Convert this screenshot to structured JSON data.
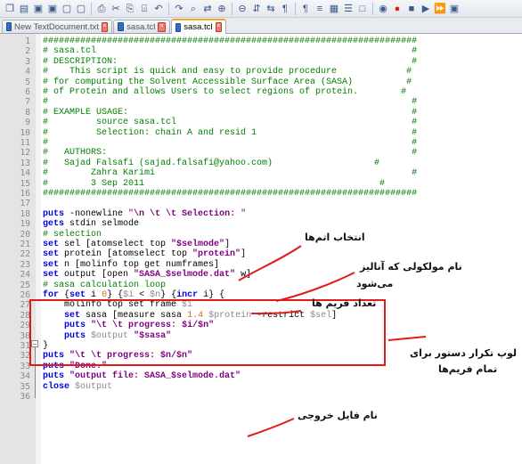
{
  "toolbar": {
    "icons": [
      "new-file-icon",
      "open-icon",
      "save-icon",
      "save-all-icon",
      "close-icon",
      "close-all-icon",
      "print-icon",
      "cut-icon",
      "copy-icon",
      "paste-icon",
      "undo-icon",
      "redo-icon",
      "find-icon",
      "replace-icon",
      "zoom-in-icon",
      "zoom-out-icon",
      "sync-v-icon",
      "sync-h-icon",
      "wrap-icon",
      "all-chars-icon",
      "indent-guide-icon",
      "doc-map-icon",
      "function-list-icon",
      "folder-icon",
      "monitor-icon",
      "record-icon",
      "stop-icon",
      "play-icon",
      "play-multi-icon",
      "save-macro-icon"
    ],
    "glyphs": [
      "❐",
      "▤",
      "▣",
      "▣",
      "▢",
      "▢",
      "⎙",
      "✂",
      "⎘",
      "⌹",
      "↶",
      "↷",
      "⌕",
      "⇄",
      "⊕",
      "⊖",
      "⇵",
      "⇆",
      "¶",
      "¶",
      "≡",
      "▦",
      "☰",
      "□",
      "◉",
      "●",
      "■",
      "▶",
      "⏩",
      "▣"
    ]
  },
  "tabs": [
    {
      "label": "New TextDocument.txt",
      "active": false
    },
    {
      "label": "sasa.tcl",
      "active": false
    },
    {
      "label": "sasa.tcl",
      "active": true
    }
  ],
  "lines": [
    {
      "n": "1",
      "segs": [
        {
          "c": "cm",
          "t": "######################################################################"
        }
      ]
    },
    {
      "n": "2",
      "segs": [
        {
          "c": "cm",
          "t": "# sasa.tcl                                                           #"
        }
      ]
    },
    {
      "n": "3",
      "segs": [
        {
          "c": "cm",
          "t": "# DESCRIPTION:                                                       #"
        }
      ]
    },
    {
      "n": "4",
      "segs": [
        {
          "c": "cm",
          "t": "#    This script is quick and easy to provide procedure             #"
        }
      ]
    },
    {
      "n": "5",
      "segs": [
        {
          "c": "cm",
          "t": "# for computing the Solvent Accessible Surface Area (SASA)          #"
        }
      ]
    },
    {
      "n": "6",
      "segs": [
        {
          "c": "cm",
          "t": "# of Protein and allows Users to select regions of protein.        #"
        }
      ]
    },
    {
      "n": "7",
      "segs": [
        {
          "c": "cm",
          "t": "#                                                                    #"
        }
      ]
    },
    {
      "n": "8",
      "segs": [
        {
          "c": "cm",
          "t": "# EXAMPLE USAGE:                                                     #"
        }
      ]
    },
    {
      "n": "9",
      "segs": [
        {
          "c": "cm",
          "t": "#         source sasa.tcl                                            #"
        }
      ]
    },
    {
      "n": "10",
      "segs": [
        {
          "c": "cm",
          "t": "#         Selection: chain A and resid 1                             #"
        }
      ]
    },
    {
      "n": "11",
      "segs": [
        {
          "c": "cm",
          "t": "#                                                                    #"
        }
      ]
    },
    {
      "n": "12",
      "segs": [
        {
          "c": "cm",
          "t": "#   AUTHORS:                                                         #"
        }
      ]
    },
    {
      "n": "13",
      "segs": [
        {
          "c": "cm",
          "t": "#   Sajad Falsafi (sajad.falsafi@yahoo.com)                   #"
        }
      ]
    },
    {
      "n": "14",
      "segs": [
        {
          "c": "cm",
          "t": "#        Zahra Karimi                                                #"
        }
      ]
    },
    {
      "n": "15",
      "segs": [
        {
          "c": "cm",
          "t": "#        3 Sep 2011                                            #"
        }
      ]
    },
    {
      "n": "16",
      "segs": [
        {
          "c": "cm",
          "t": "######################################################################"
        }
      ]
    },
    {
      "n": "17",
      "segs": []
    },
    {
      "n": "18",
      "segs": [
        {
          "c": "kw",
          "t": "puts"
        },
        {
          "c": "op",
          "t": " -nonewline "
        },
        {
          "c": "stn",
          "t": "\""
        },
        {
          "c": "st",
          "t": "\\n \\t \\t Selection: "
        },
        {
          "c": "stn",
          "t": "\""
        }
      ]
    },
    {
      "n": "19",
      "segs": [
        {
          "c": "kw",
          "t": "gets"
        },
        {
          "c": "op",
          "t": " stdin selmode"
        }
      ]
    },
    {
      "n": "20",
      "segs": [
        {
          "c": "cm",
          "t": "# selection"
        }
      ]
    },
    {
      "n": "21",
      "segs": [
        {
          "c": "kw",
          "t": "set"
        },
        {
          "c": "op",
          "t": " sel [atomselect top "
        },
        {
          "c": "st",
          "t": "\"$selmode\""
        },
        {
          "c": "op",
          "t": "]"
        }
      ]
    },
    {
      "n": "22",
      "segs": [
        {
          "c": "kw",
          "t": "set"
        },
        {
          "c": "op",
          "t": " protein [atomselect top "
        },
        {
          "c": "st",
          "t": "\"protein\""
        },
        {
          "c": "op",
          "t": "]"
        }
      ]
    },
    {
      "n": "23",
      "segs": [
        {
          "c": "kw",
          "t": "set"
        },
        {
          "c": "op",
          "t": " n [molinfo top get numframes]"
        }
      ]
    },
    {
      "n": "24",
      "segs": [
        {
          "c": "kw",
          "t": "set"
        },
        {
          "c": "op",
          "t": " output [open "
        },
        {
          "c": "st",
          "t": "\"SASA_$selmode.dat\""
        },
        {
          "c": "op",
          "t": " w]"
        }
      ]
    },
    {
      "n": "25",
      "segs": [
        {
          "c": "cm",
          "t": "# sasa calculation loop"
        }
      ]
    },
    {
      "n": "26",
      "segs": [
        {
          "c": "kw",
          "t": "for"
        },
        {
          "c": "op",
          "t": " {"
        },
        {
          "c": "kw",
          "t": "set"
        },
        {
          "c": "op",
          "t": " i "
        },
        {
          "c": "nm",
          "t": "0"
        },
        {
          "c": "op",
          "t": "} {"
        },
        {
          "c": "vr",
          "t": "$i"
        },
        {
          "c": "op",
          "t": " < "
        },
        {
          "c": "vr",
          "t": "$n"
        },
        {
          "c": "op",
          "t": "} {"
        },
        {
          "c": "kw",
          "t": "incr"
        },
        {
          "c": "op",
          "t": " i} {"
        }
      ]
    },
    {
      "n": "27",
      "segs": [
        {
          "c": "op",
          "t": "    molinfo top set frame "
        },
        {
          "c": "vr",
          "t": "$i"
        }
      ]
    },
    {
      "n": "28",
      "segs": [
        {
          "c": "op",
          "t": "    "
        },
        {
          "c": "kw",
          "t": "set"
        },
        {
          "c": "op",
          "t": " sasa [measure sasa "
        },
        {
          "c": "nm",
          "t": "1.4"
        },
        {
          "c": "op",
          "t": " "
        },
        {
          "c": "vr",
          "t": "$protein"
        },
        {
          "c": "op",
          "t": " -restrict "
        },
        {
          "c": "vr",
          "t": "$sel"
        },
        {
          "c": "op",
          "t": "]"
        }
      ]
    },
    {
      "n": "29",
      "segs": [
        {
          "c": "op",
          "t": "    "
        },
        {
          "c": "kw",
          "t": "puts"
        },
        {
          "c": "op",
          "t": " "
        },
        {
          "c": "st",
          "t": "\"\\t \\t progress: $i/$n\""
        }
      ]
    },
    {
      "n": "30",
      "segs": [
        {
          "c": "op",
          "t": "    "
        },
        {
          "c": "kw",
          "t": "puts"
        },
        {
          "c": "op",
          "t": " "
        },
        {
          "c": "vr",
          "t": "$output"
        },
        {
          "c": "op",
          "t": " "
        },
        {
          "c": "st",
          "t": "\"$sasa\""
        }
      ]
    },
    {
      "n": "31",
      "segs": [
        {
          "c": "op",
          "t": "}"
        }
      ]
    },
    {
      "n": "32",
      "segs": [
        {
          "c": "kw",
          "t": "puts"
        },
        {
          "c": "op",
          "t": " "
        },
        {
          "c": "st",
          "t": "\"\\t \\t progress: $n/$n\""
        }
      ]
    },
    {
      "n": "33",
      "segs": [
        {
          "c": "kw",
          "t": "puts"
        },
        {
          "c": "op",
          "t": " "
        },
        {
          "c": "st",
          "t": "\"Done.\""
        }
      ]
    },
    {
      "n": "34",
      "segs": [
        {
          "c": "kw",
          "t": "puts"
        },
        {
          "c": "op",
          "t": " "
        },
        {
          "c": "st",
          "t": "\"output file: SASA_$selmode.dat\""
        }
      ]
    },
    {
      "n": "35",
      "segs": [
        {
          "c": "kw",
          "t": "close"
        },
        {
          "c": "op",
          "t": " "
        },
        {
          "c": "vr",
          "t": "$output"
        }
      ]
    },
    {
      "n": "36",
      "segs": []
    }
  ],
  "annotations": {
    "atom_selection": "انتخاب اتم‌ها",
    "molecule_name_1": "نام مولکولی که آنالیز",
    "molecule_name_2": "می‌شود",
    "frame_count": "تعداد فریم ها",
    "loop_1": "لوپ تکرار دستور برای",
    "loop_2": "تمام فریم‌ها",
    "output_file": "نام فایل خروجی"
  },
  "colors": {
    "comment": "#007f00",
    "keyword": "#0000e6",
    "string": "#7f007f",
    "variable": "#8a8a8a",
    "number": "#d07000",
    "highlight_box": "#e11b1b"
  }
}
